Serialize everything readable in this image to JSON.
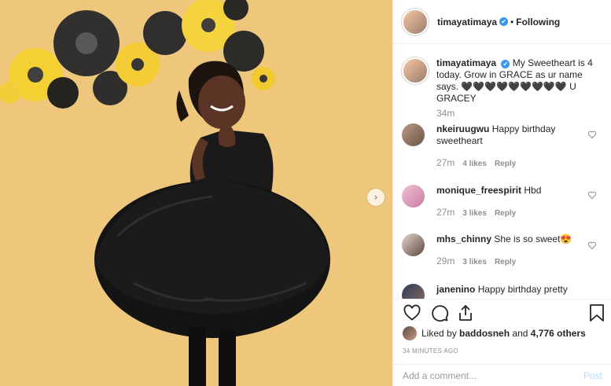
{
  "post": {
    "username": "timayatimaya",
    "verified_mark": "✔",
    "separator": "•",
    "follow_status": "Following",
    "caption_text": "My Sweetheart is 4 today. Grow in GRACE as ur name says. 🖤🖤🖤🖤🖤🖤🖤🖤🖤 U GRACEY",
    "caption_time": "34m"
  },
  "comments": [
    {
      "username": "nkeiruugwu",
      "text": "Happy birthday sweetheart",
      "time": "27m",
      "likes": "4 likes",
      "reply": "Reply"
    },
    {
      "username": "monique_freespirit",
      "text": "Hbd",
      "time": "27m",
      "likes": "3 likes",
      "reply": "Reply"
    },
    {
      "username": "mhs_chinny",
      "text": "She is so sweet😍",
      "time": "29m",
      "likes": "3 likes",
      "reply": "Reply"
    },
    {
      "username": "janenino",
      "text": "Happy birthday pretty"
    }
  ],
  "likes": {
    "prefix": "Liked by",
    "user": "baddosneh",
    "joiner": "and",
    "others": "4,776 others"
  },
  "timestamp": "34 MINUTES AGO",
  "add_comment": {
    "placeholder": "Add a comment...",
    "post_label": "Post"
  },
  "icons": {
    "next": "chevron-right-icon",
    "like": "heart-icon",
    "comment": "comment-bubble-icon",
    "share": "share-icon",
    "save": "bookmark-icon"
  },
  "colors": {
    "photo_background": "#eec77d",
    "verified": "#3897f0",
    "post_disabled": "#b2dffc",
    "muted": "#8e8e8e"
  }
}
